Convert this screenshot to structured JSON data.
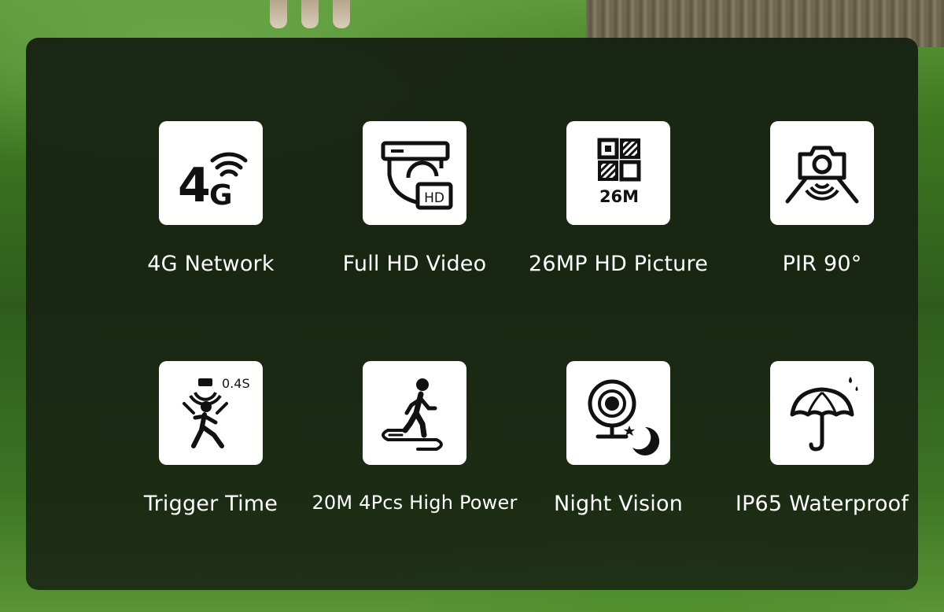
{
  "features": [
    {
      "label": "4G Network",
      "icon": "4g-signal-icon",
      "icon_text": [
        "4",
        "G"
      ]
    },
    {
      "label": "Full HD Video",
      "icon": "hd-camera-icon",
      "icon_text": [
        "HD"
      ]
    },
    {
      "label": "26MP HD Picture",
      "icon": "megapixel-grid-icon",
      "icon_text": [
        "26M"
      ]
    },
    {
      "label": "PIR 90°",
      "icon": "pir-sensor-camera-icon",
      "icon_text": []
    },
    {
      "label": "Trigger Time",
      "icon": "trigger-motion-icon",
      "icon_text": [
        "0.4S"
      ]
    },
    {
      "label": "20M 4Pcs High Power",
      "icon": "walking-person-path-icon",
      "icon_text": []
    },
    {
      "label": "Night Vision",
      "icon": "night-vision-webcam-icon",
      "icon_text": []
    },
    {
      "label": "IP65 Waterproof",
      "icon": "umbrella-rain-icon",
      "icon_text": []
    }
  ],
  "colors": {
    "panel": "#18241a",
    "tile": "#ffffff",
    "icon": "#111111",
    "label": "#ffffff"
  }
}
